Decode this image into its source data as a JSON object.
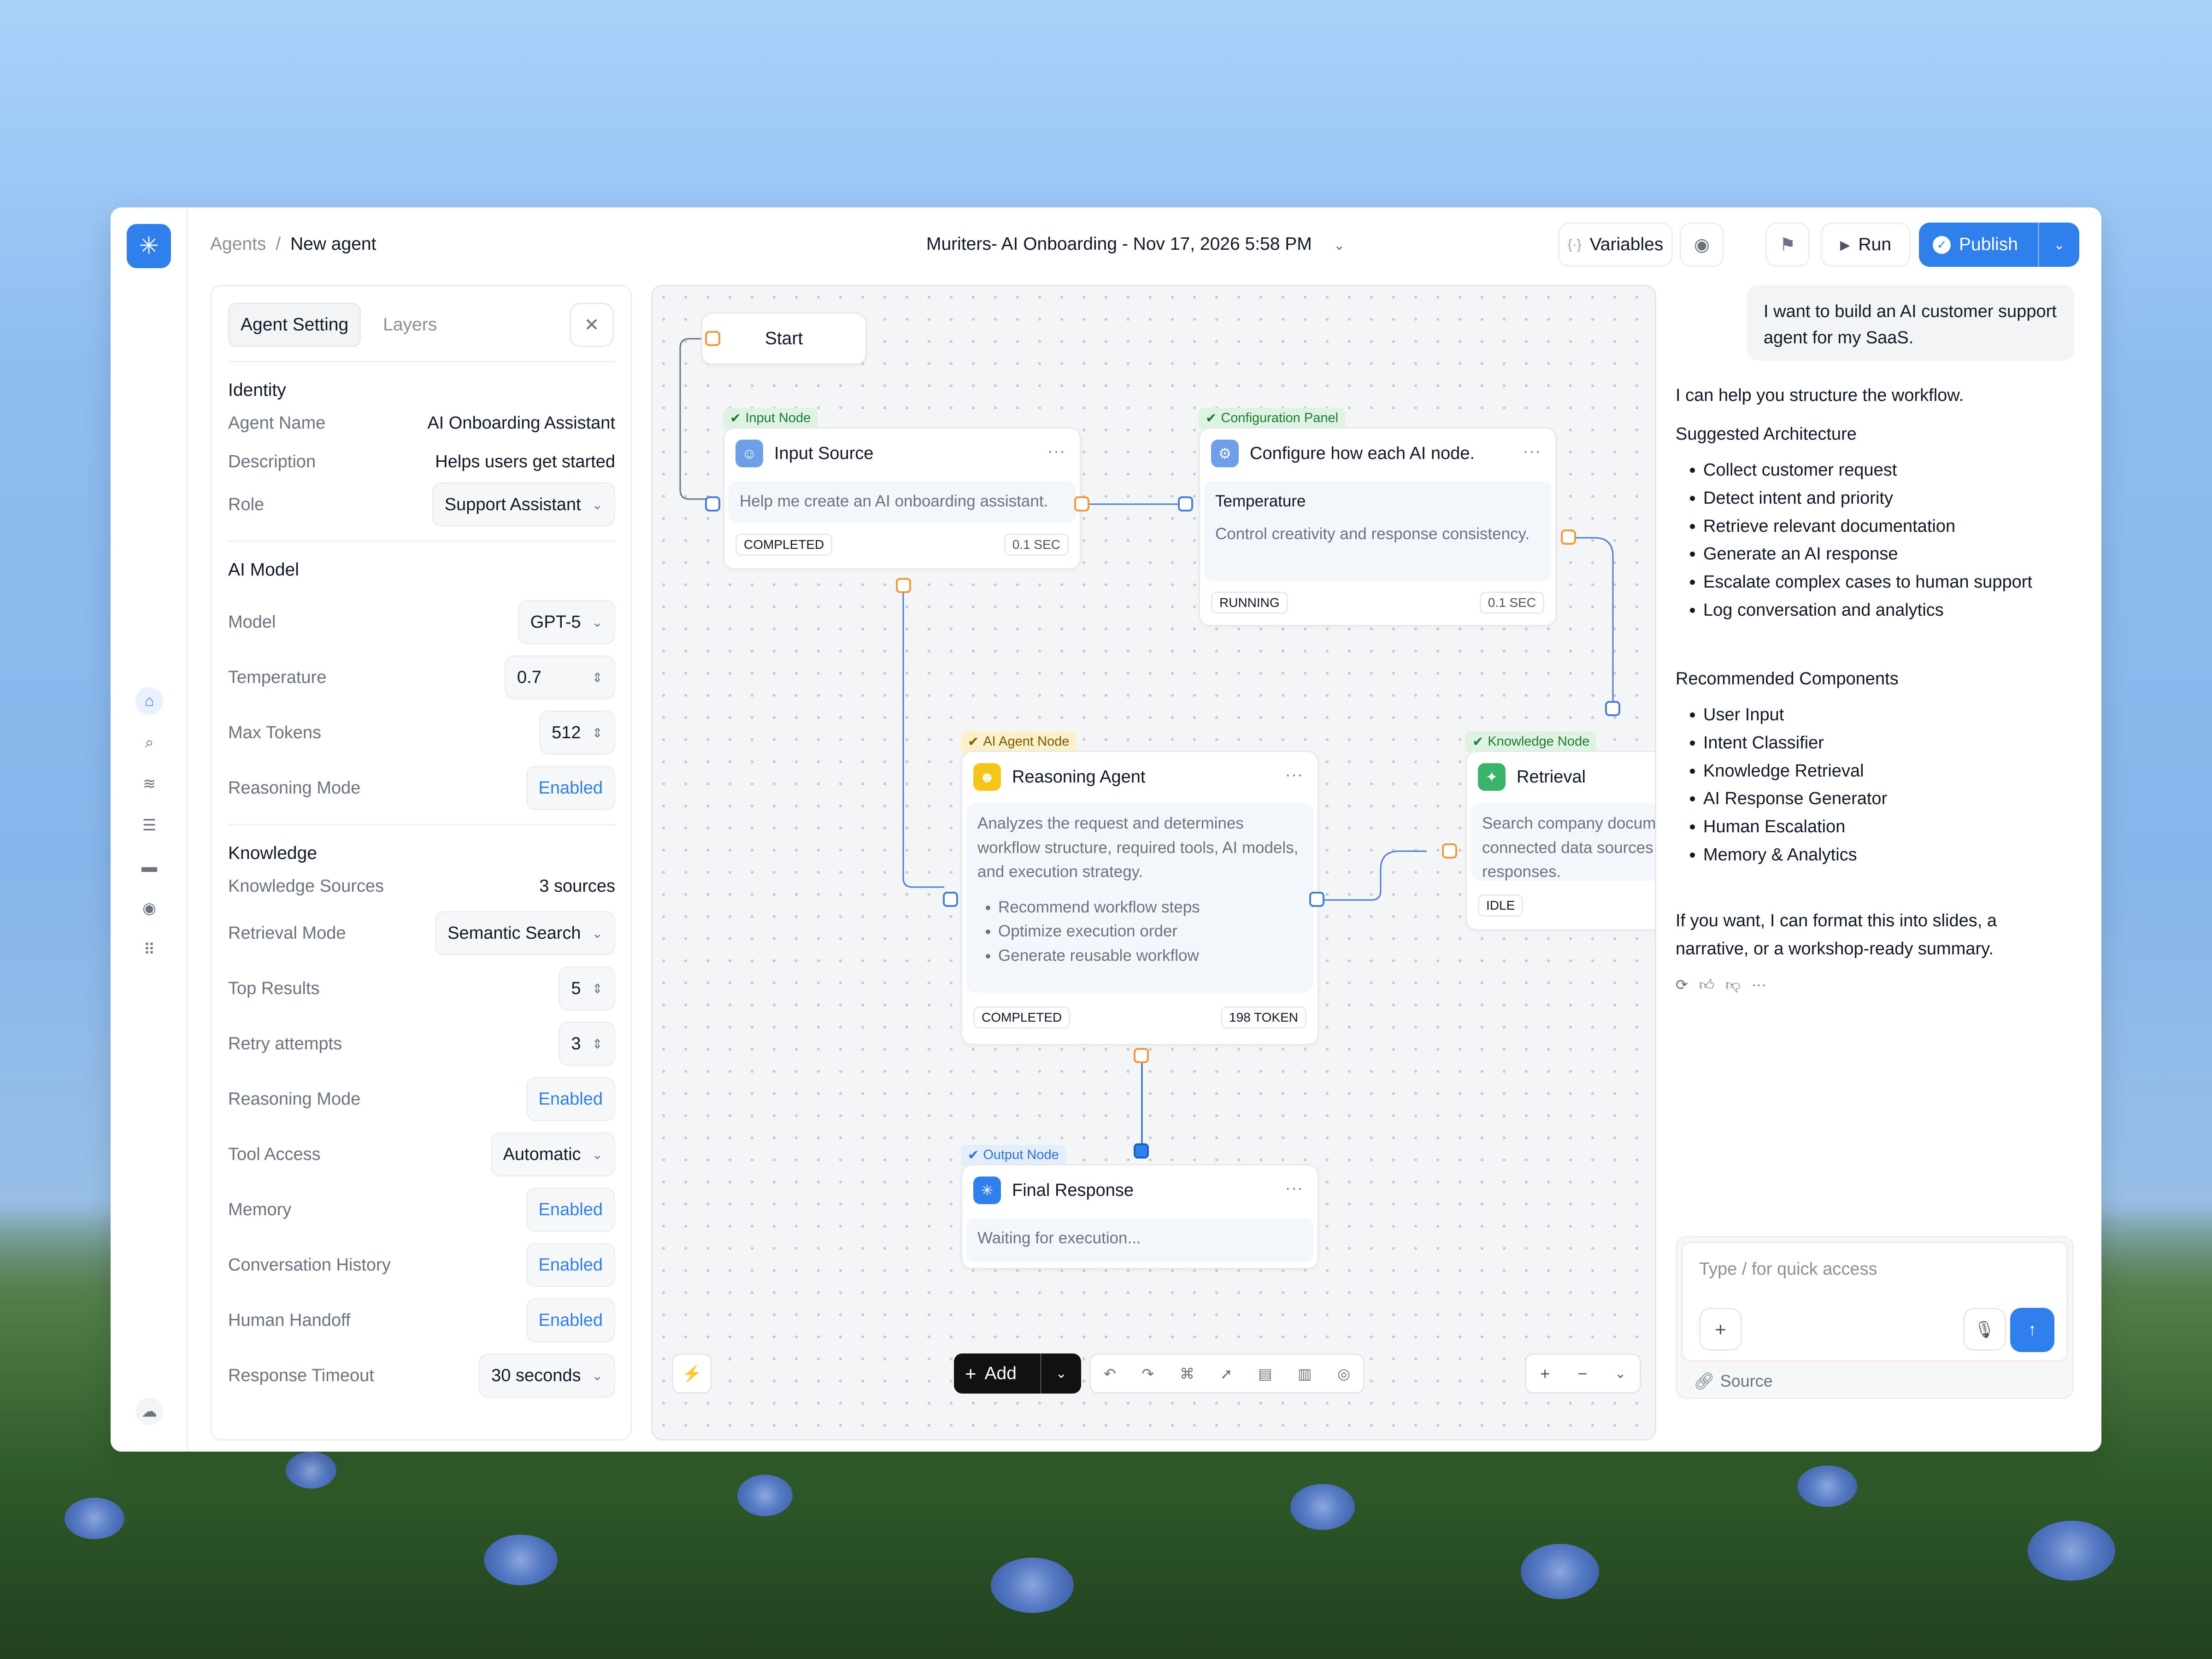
{
  "header": {
    "breadcrumb_parent": "Agents",
    "breadcrumb_sep": "/",
    "breadcrumb_current": "New agent",
    "doc_title": "Muriters- AI Onboarding - Nov 17, 2026 5:58 PM",
    "variables_label": "Variables",
    "run_label": "Run",
    "publish_label": "Publish"
  },
  "left_panel": {
    "tabs": [
      "Agent Setting",
      "Layers"
    ],
    "identity": {
      "title": "Identity",
      "agent_name_label": "Agent Name",
      "agent_name": "AI Onboarding Assistant",
      "description_label": "Description",
      "description": "Helps users get started",
      "role_label": "Role",
      "role": "Support Assistant"
    },
    "ai_model": {
      "title": "AI Model",
      "model_label": "Model",
      "model": "GPT-5",
      "temperature_label": "Temperature",
      "temperature": "0.7",
      "max_tokens_label": "Max Tokens",
      "max_tokens": "512",
      "reasoning_label": "Reasoning Mode",
      "reasoning": "Enabled"
    },
    "knowledge": {
      "title": "Knowledge",
      "sources_label": "Knowledge Sources",
      "sources": "3 sources",
      "retrieval_label": "Retrieval Mode",
      "retrieval": "Semantic Search",
      "top_label": "Top Results",
      "top": "5",
      "retry_label": "Retry attempts",
      "retry": "3",
      "reasoning_label": "Reasoning Mode",
      "reasoning": "Enabled",
      "tool_label": "Tool Access",
      "tool": "Automatic",
      "memory_label": "Memory",
      "memory": "Enabled",
      "history_label": "Conversation History",
      "history": "Enabled",
      "handoff_label": "Human Handoff",
      "handoff": "Enabled",
      "timeout_label": "Response Timeout",
      "timeout": "30 seconds"
    }
  },
  "canvas": {
    "start_label": "Start",
    "input_node": {
      "badge": "Input Node",
      "title": "Input Source",
      "body": "Help me create an AI onboarding assistant.",
      "status": "COMPLETED",
      "metric": "0.1 SEC"
    },
    "config_node": {
      "badge": "Configuration Panel",
      "title": "Configure how each AI node.",
      "sub_title": "Temperature",
      "body": "Control creativity and response consistency.",
      "status": "RUNNING",
      "metric": "0.1 SEC"
    },
    "agent_node": {
      "badge": "AI Agent Node",
      "title": "Reasoning Agent",
      "body": "Analyzes the request and determines workflow structure, required tools, AI models, and execution strategy.",
      "bullets": [
        "Recommend workflow steps",
        "Optimize execution order",
        "Generate reusable workflow"
      ],
      "status": "COMPLETED",
      "metric": "198 TOKEN"
    },
    "knowledge_node": {
      "badge": "Knowledge Node",
      "title": "Retrieval",
      "body": "Search company documentation and connected data sources to ground responses.",
      "status": "IDLE"
    },
    "output_node": {
      "badge": "Output Node",
      "title": "Final Response",
      "body": "Waiting for execution..."
    },
    "add_label": "Add"
  },
  "chat": {
    "user_message": "I want to build an AI customer support agent for my SaaS.",
    "intro": "I can help you structure the workflow.",
    "arch_title": "Suggested Architecture",
    "arch_items": [
      "Collect customer request",
      "Detect intent and priority",
      "Retrieve relevant documentation",
      "Generate an AI response",
      "Escalate complex cases to human support",
      "Log conversation and analytics"
    ],
    "comp_title": "Recommended Components",
    "comp_items": [
      "User Input",
      "Intent Classifier",
      "Knowledge Retrieval",
      "AI Response Generator",
      "Human Escalation",
      "Memory & Analytics"
    ],
    "outro": "If you want, I can format this into slides, a narrative, or a workshop-ready summary.",
    "composer_placeholder": "Type / for quick access",
    "source_label": "Source"
  },
  "colors": {
    "accent": "#2f80ed",
    "completed": "#1f7a34",
    "agent_badge": "#fbf0c8",
    "port_orange": "#f29a3a",
    "port_blue": "#4a7ed6"
  },
  "icons": [
    "sparkle-logo-icon",
    "home-icon",
    "search-icon",
    "layers-icon",
    "database-icon",
    "folder-icon",
    "compass-icon",
    "grid-icon",
    "cloud-icon",
    "variables-icon",
    "record-icon",
    "flag-icon",
    "play-icon",
    "check-circle-icon",
    "close-icon",
    "chevron-down-icon",
    "stepper-icon",
    "more-icon",
    "lightning-icon",
    "undo-icon",
    "redo-icon",
    "zoom-in-icon",
    "zoom-out-icon",
    "regenerate-icon",
    "thumbs-up-icon",
    "thumbs-down-icon",
    "plus-icon",
    "mic-icon",
    "send-icon",
    "link-icon"
  ]
}
